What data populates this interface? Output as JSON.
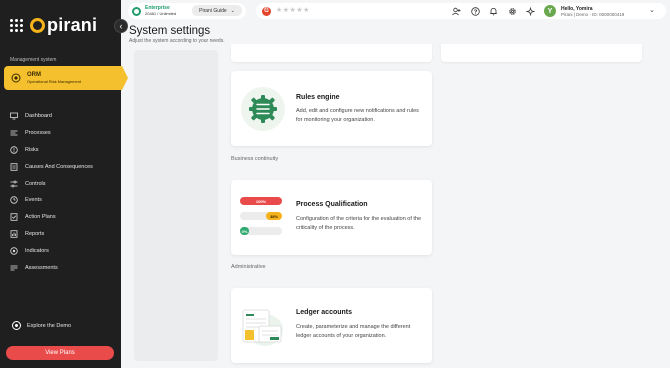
{
  "brand": {
    "name": "pirani"
  },
  "sidebar": {
    "section_label": "Management system",
    "module": {
      "title": "ORM",
      "subtitle": "Operational Risk Management"
    },
    "items": [
      {
        "label": "Dashboard",
        "icon": "monitor-icon"
      },
      {
        "label": "Processes",
        "icon": "process-icon"
      },
      {
        "label": "Risks",
        "icon": "risk-icon"
      },
      {
        "label": "Causes And Consequences",
        "icon": "causes-icon"
      },
      {
        "label": "Controls",
        "icon": "controls-icon"
      },
      {
        "label": "Events",
        "icon": "events-icon"
      },
      {
        "label": "Action Plans",
        "icon": "action-plans-icon"
      },
      {
        "label": "Reports",
        "icon": "reports-icon"
      },
      {
        "label": "Indicators",
        "icon": "indicators-icon"
      },
      {
        "label": "Assessments",
        "icon": "assessments-icon"
      }
    ],
    "explore_label": "Explore the Demo",
    "view_plans_label": "View Plans"
  },
  "topbar": {
    "plan_title": "Enterprise",
    "plan_sub": "20481 / Unlimited",
    "guide_label": "Pirani Guide",
    "rating_letter": "G",
    "stars": "★★★★★",
    "user": {
      "avatar_letter": "Y",
      "greeting": "Hello, Yomira",
      "sub": "Pirani | Demo - ID: 0000000419"
    }
  },
  "page": {
    "title": "System settings",
    "subtitle": "Adjust the system according to your needs."
  },
  "cards": [
    {
      "title": "Rules engine",
      "description": "Add, edit and configure new notifications and rules for monitoring your organization."
    },
    {
      "section": "Business continuity",
      "title": "Process Qualification",
      "description": "Configuration of the criteria for the evaluation of the criticality of the process.",
      "bars": [
        {
          "label": "100%",
          "value": 1.0,
          "color": "#e94b4b"
        },
        {
          "label": "38%",
          "value": 0.38,
          "color": "#f5b21a"
        },
        {
          "label": "0%",
          "value": 0.0,
          "color": "#2eaa6e"
        }
      ]
    },
    {
      "section": "Administrative",
      "title": "Ledger accounts",
      "description": "Create, parameterize and manage the different ledger accounts of your organization."
    }
  ],
  "colors": {
    "accent": "#f5c02e",
    "danger": "#e94b4b",
    "brand_green": "#1f9d6e",
    "sidebar_bg": "#1f1f1f"
  }
}
